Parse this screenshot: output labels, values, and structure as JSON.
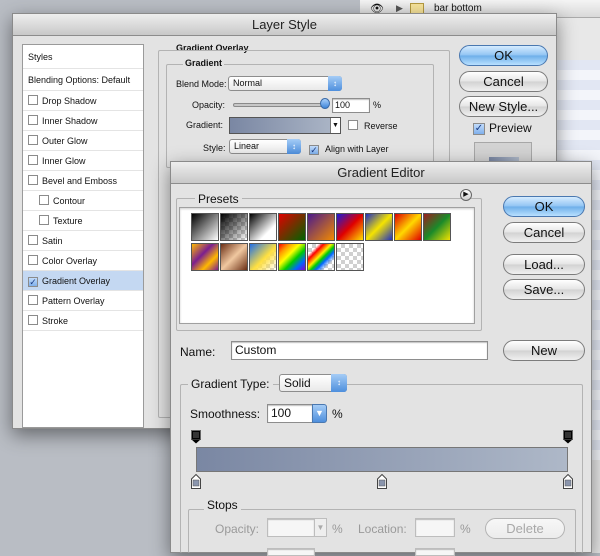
{
  "background": {
    "layer_name": "bar bottom"
  },
  "layer_style": {
    "title": "Layer Style",
    "styles_header": "Styles",
    "blending_options": "Blending Options: Default",
    "items": [
      {
        "label": "Drop Shadow",
        "checked": false,
        "selected": false,
        "indent": false
      },
      {
        "label": "Inner Shadow",
        "checked": false,
        "selected": false,
        "indent": false
      },
      {
        "label": "Outer Glow",
        "checked": false,
        "selected": false,
        "indent": false
      },
      {
        "label": "Inner Glow",
        "checked": false,
        "selected": false,
        "indent": false
      },
      {
        "label": "Bevel and Emboss",
        "checked": false,
        "selected": false,
        "indent": false
      },
      {
        "label": "Contour",
        "checked": false,
        "selected": false,
        "indent": true
      },
      {
        "label": "Texture",
        "checked": false,
        "selected": false,
        "indent": true
      },
      {
        "label": "Satin",
        "checked": false,
        "selected": false,
        "indent": false
      },
      {
        "label": "Color Overlay",
        "checked": false,
        "selected": false,
        "indent": false
      },
      {
        "label": "Gradient Overlay",
        "checked": true,
        "selected": true,
        "indent": false
      },
      {
        "label": "Pattern Overlay",
        "checked": false,
        "selected": false,
        "indent": false
      },
      {
        "label": "Stroke",
        "checked": false,
        "selected": false,
        "indent": false
      }
    ],
    "section_title": "Gradient Overlay",
    "group_title": "Gradient",
    "blend_mode_label": "Blend Mode:",
    "blend_mode_value": "Normal",
    "opacity_label": "Opacity:",
    "opacity_value": "100",
    "opacity_unit": "%",
    "opacity_fraction": 1.0,
    "gradient_label": "Gradient:",
    "reverse_label": "Reverse",
    "style_label": "Style:",
    "style_value": "Linear",
    "align_label": "Align with Layer",
    "ok_label": "OK",
    "cancel_label": "Cancel",
    "new_style_label": "New Style...",
    "preview_label": "Preview"
  },
  "gradient_editor": {
    "title": "Gradient Editor",
    "presets_label": "Presets",
    "ok_label": "OK",
    "cancel_label": "Cancel",
    "load_label": "Load...",
    "save_label": "Save...",
    "name_label": "Name:",
    "name_value": "Custom",
    "new_label": "New",
    "type_label": "Gradient Type:",
    "type_value": "Solid",
    "smoothness_label": "Smoothness:",
    "smoothness_value": "100",
    "smoothness_unit": "%",
    "stops_title": "Stops",
    "stop_opacity_label": "Opacity:",
    "stop_opacity_unit": "%",
    "location_label": "Location:",
    "location_unit": "%",
    "delete_label": "Delete",
    "gradient_colors": [
      "#7a87a3",
      "#aeb8c8"
    ],
    "color_stop_locations": [
      0,
      0.5,
      1
    ],
    "opacity_stop_locations": [
      0,
      1
    ]
  }
}
